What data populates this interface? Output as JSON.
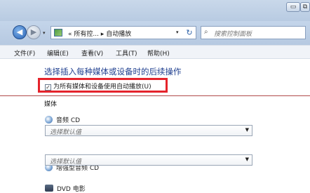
{
  "window": {
    "minimize_glyph": "▭",
    "restore_glyph": "⧉"
  },
  "nav": {
    "back_glyph": "◀",
    "forward_glyph": "▶",
    "history_glyph": "▾",
    "address_text": "« 所有控...  ▸  自动播放",
    "address_dropdown_glyph": "▾",
    "refresh_glyph": "↻",
    "search_placeholder": "搜索控制面板"
  },
  "menu": {
    "items": [
      "文件(F)",
      "编辑(E)",
      "查看(V)",
      "工具(T)",
      "帮助(H)"
    ]
  },
  "content": {
    "heading": "选择插入每种媒体或设备时的后续操作",
    "checkbox_label": "为所有媒体和设备使用自动播放(U)",
    "checkbox_checked": true,
    "section_label": "媒体",
    "media": [
      {
        "label": "音频 CD",
        "select_value": "选择默认值"
      },
      {
        "label": "增强型音频 CD",
        "select_value": "选择默认值"
      },
      {
        "label": "DVD 电影"
      }
    ]
  },
  "colors": {
    "highlight_border": "#e5232b",
    "heading_text": "#1f3f8f"
  }
}
